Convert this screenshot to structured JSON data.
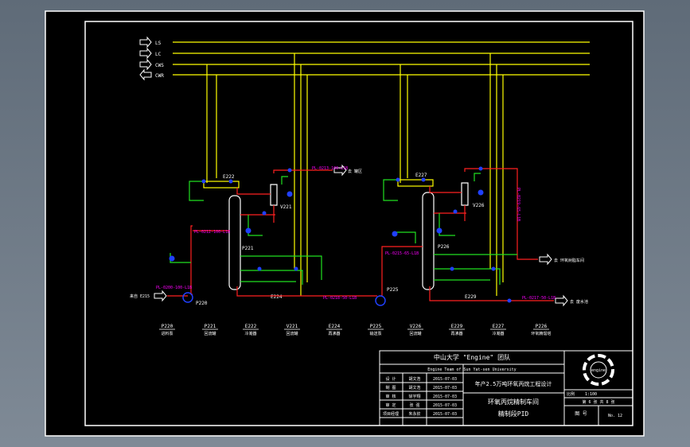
{
  "headers": [
    {
      "id": "h-ls",
      "dir": "out",
      "label": "LS"
    },
    {
      "id": "h-lc",
      "dir": "out",
      "label": "LC"
    },
    {
      "id": "h-cws",
      "dir": "out",
      "label": "CWS"
    },
    {
      "id": "h-cwr",
      "dir": "in",
      "label": "CWR"
    }
  ],
  "tags": {
    "e222": "E222",
    "e227": "E227",
    "v221": "V221",
    "v226": "V226",
    "p221": "P221",
    "p226": "P226",
    "e224": "E224",
    "e229": "E229",
    "p225": "P225",
    "p220": "P220"
  },
  "lines": {
    "l1": "PL-0213-100-L1B",
    "l1dest": "去 罐区",
    "l2": "PL-0212-100-L1B",
    "l3": "PL-0200-100-L1B",
    "l4": "PL-0218-50-L1B",
    "l5": "PL-0215-65-L1B",
    "l6": "PL-0219-65-L1B",
    "l6dest": "去 环氧树脂车间",
    "l7": "PL-0217-50-L1B",
    "l7dest": "去 废水池",
    "feed": "来自 E215"
  },
  "legend": [
    {
      "tag": "P220",
      "name": "进料泵"
    },
    {
      "tag": "P221",
      "name": "回流罐"
    },
    {
      "tag": "E222",
      "name": "冷凝器"
    },
    {
      "tag": "V221",
      "name": "回流罐"
    },
    {
      "tag": "E224",
      "name": "再沸器"
    },
    {
      "tag": "P225",
      "name": "输送泵"
    },
    {
      "tag": "V226",
      "name": "回流罐"
    },
    {
      "tag": "E229",
      "name": "再沸器"
    },
    {
      "tag": "E227",
      "name": "冷凝器"
    },
    {
      "tag": "P226",
      "name": "环氧精馏塔"
    }
  ],
  "title_block": {
    "org": "中山大学 \"Engine\" 团队",
    "org_en": "Engine Team of Sun Yat-sen University",
    "project": "年产2.5万吨环氧丙烷工程设计",
    "roles": [
      {
        "role": "设 计",
        "name": "胡文浩",
        "date": "2015-07-03"
      },
      {
        "role": "制 图",
        "name": "胡文浩",
        "date": "2015-07-03"
      },
      {
        "role": "审 核",
        "name": "徐宇翔",
        "date": "2015-07-03"
      },
      {
        "role": "审 定",
        "name": "张 强",
        "date": "2015-07-03"
      },
      {
        "role": "项目经理",
        "name": "朱永钦",
        "date": "2015-07-03"
      }
    ],
    "drawing_name": "环氧丙烷精制车间",
    "drawing_sub": "精制段PID",
    "scale_label": "比例",
    "scale": "1:100",
    "sheet": "第 6 张 共 8 张",
    "dwg_no_label": "图 号",
    "dwg_no": "No. 12"
  },
  "colors": {
    "yellow": "#ffff00",
    "red": "#ff2020",
    "green": "#20e020",
    "magenta": "#ff00ff",
    "blue": "#2040ff",
    "white": "#ffffff"
  }
}
